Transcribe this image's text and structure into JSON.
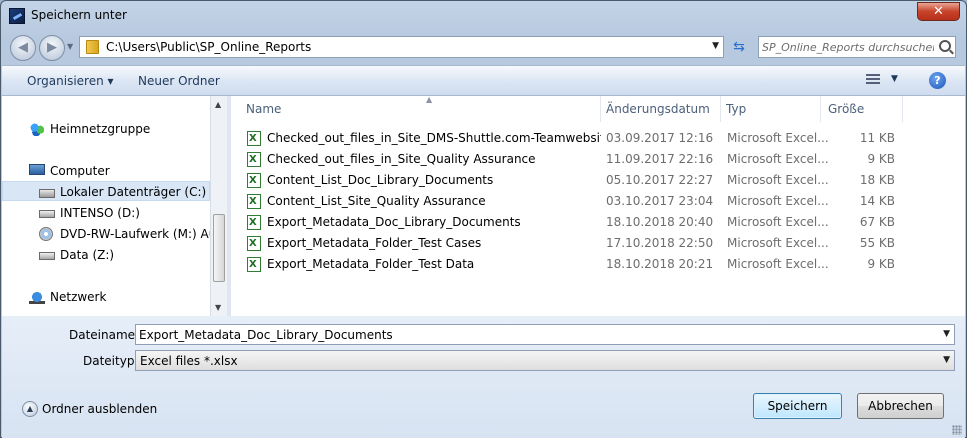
{
  "window": {
    "title": "Speichern unter",
    "close_label": "✕"
  },
  "address": {
    "path": "C:\\Users\\Public\\SP_Online_Reports"
  },
  "search": {
    "placeholder": "SP_Online_Reports durchsuchen"
  },
  "toolbar": {
    "organize_label": "Organisieren ▾",
    "new_folder_label": "Neuer Ordner",
    "help_label": "?"
  },
  "nav": {
    "items": [
      {
        "label": "Heimnetzgruppe",
        "icon": "homegroup-icon"
      },
      {
        "label": "Computer",
        "icon": "computer-icon"
      },
      {
        "label": "Lokaler Datenträger (C:)",
        "icon": "system-drive-icon",
        "selected": true
      },
      {
        "label": "INTENSO (D:)",
        "icon": "drive-icon"
      },
      {
        "label": "DVD-RW-Laufwerk (M:) Aud",
        "icon": "dvd-icon"
      },
      {
        "label": "Data (Z:)",
        "icon": "drive-icon"
      },
      {
        "label": "Netzwerk",
        "icon": "network-icon"
      }
    ]
  },
  "columns": {
    "name": "Name",
    "date": "Änderungsdatum",
    "type": "Typ",
    "size": "Größe"
  },
  "files": [
    {
      "name": "Checked_out_files_in_Site_DMS-Shuttle.com-Teamwebsite",
      "date": "03.09.2017 12:16",
      "type": "Microsoft Excel...",
      "size": "11 KB"
    },
    {
      "name": "Checked_out_files_in_Site_Quality Assurance",
      "date": "11.09.2017 22:16",
      "type": "Microsoft Excel...",
      "size": "9 KB"
    },
    {
      "name": "Content_List_Doc_Library_Documents",
      "date": "05.10.2017 22:27",
      "type": "Microsoft Excel...",
      "size": "18 KB"
    },
    {
      "name": "Content_List_Site_Quality Assurance",
      "date": "03.10.2017 23:04",
      "type": "Microsoft Excel...",
      "size": "14 KB"
    },
    {
      "name": "Export_Metadata_Doc_Library_Documents",
      "date": "18.10.2018 20:40",
      "type": "Microsoft Excel...",
      "size": "67 KB"
    },
    {
      "name": "Export_Metadata_Folder_Test Cases",
      "date": "17.10.2018 22:50",
      "type": "Microsoft Excel...",
      "size": "55 KB"
    },
    {
      "name": "Export_Metadata_Folder_Test Data",
      "date": "18.10.2018 20:21",
      "type": "Microsoft Excel...",
      "size": "9 KB"
    }
  ],
  "form": {
    "filename_label": "Dateiname:",
    "filename_value": "Export_Metadata_Doc_Library_Documents",
    "filetype_label": "Dateityp:",
    "filetype_value": "Excel files *.xlsx",
    "hide_folders_label": "Ordner ausblenden",
    "save_label": "Speichern",
    "cancel_label": "Abbrechen"
  }
}
